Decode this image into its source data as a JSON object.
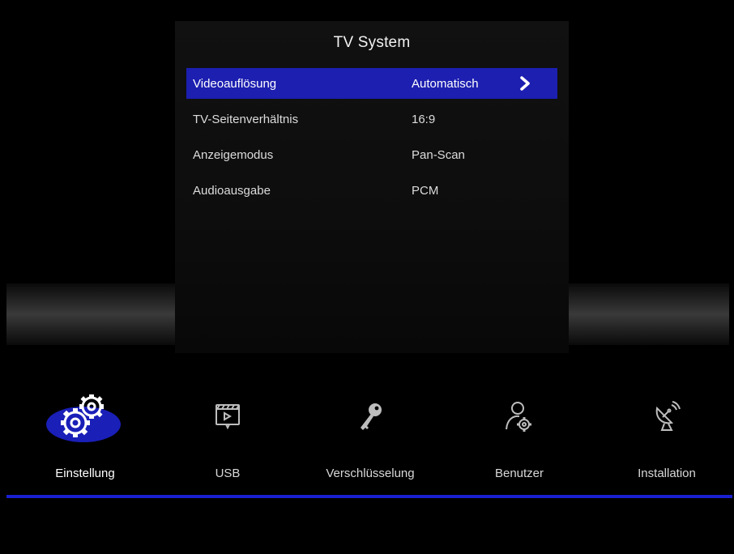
{
  "panel": {
    "title": "TV System",
    "items": [
      {
        "label": "Videoauflösung",
        "value": "Automatisch",
        "selected": true
      },
      {
        "label": "TV-Seitenverhältnis",
        "value": "16:9",
        "selected": false
      },
      {
        "label": "Anzeigemodus",
        "value": "Pan-Scan",
        "selected": false
      },
      {
        "label": "Audioausgabe",
        "value": "PCM",
        "selected": false
      }
    ]
  },
  "nav": {
    "items": [
      {
        "label": "Einstellung",
        "icon": "gears-icon",
        "active": true
      },
      {
        "label": "USB",
        "icon": "usb-media-icon",
        "active": false
      },
      {
        "label": "Verschlüsselung",
        "icon": "key-icon",
        "active": false
      },
      {
        "label": "Benutzer",
        "icon": "user-settings-icon",
        "active": false
      },
      {
        "label": "Installation",
        "icon": "satellite-dish-icon",
        "active": false
      }
    ]
  },
  "colors": {
    "accent": "#1c1fb0",
    "background": "#000000",
    "line": "#1a1fd0"
  }
}
